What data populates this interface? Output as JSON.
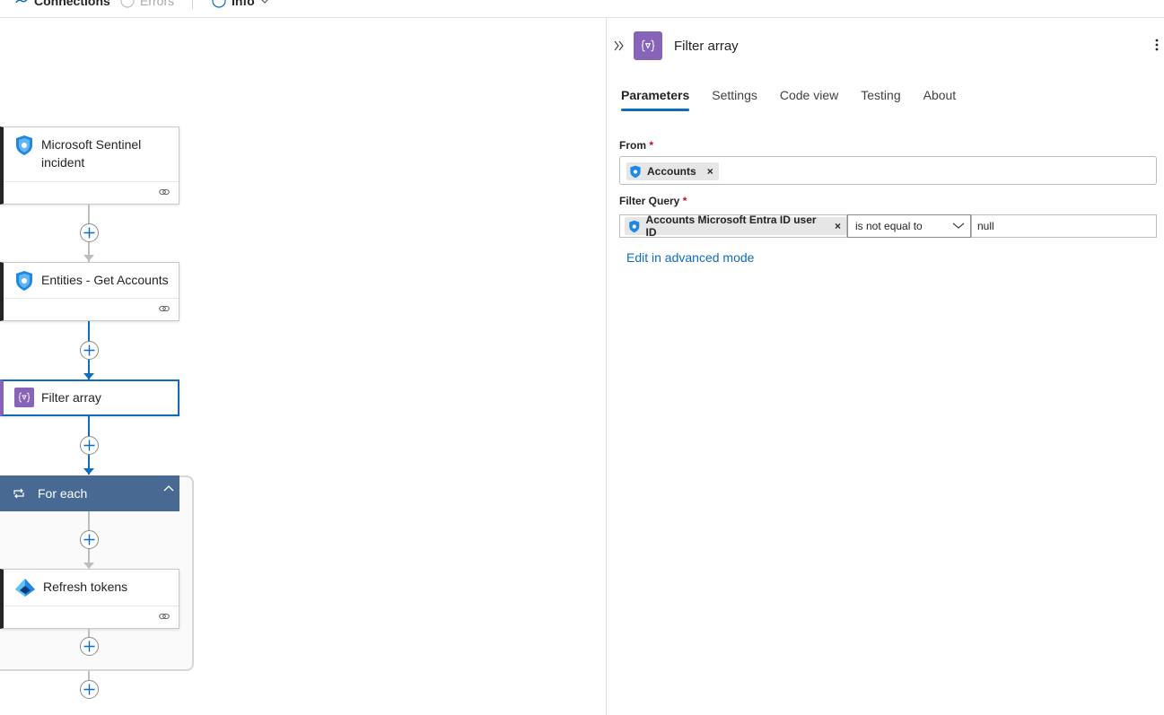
{
  "toolbar": {
    "connections_label": "Connections",
    "errors_label": "Errors",
    "info_label": "Info"
  },
  "canvas": {
    "nodes": {
      "sentinel": {
        "title": "Microsoft Sentinel incident",
        "line1": "Microsoft Sentinel",
        "line2": "incident"
      },
      "entities": {
        "title": "Entities - Get Accounts"
      },
      "filter": {
        "title": "Filter array"
      },
      "foreach": {
        "title": "For each"
      },
      "refresh": {
        "title": "Refresh tokens"
      }
    }
  },
  "panel": {
    "title": "Filter array",
    "tabs": [
      {
        "label": "Parameters",
        "active": true
      },
      {
        "label": "Settings",
        "active": false
      },
      {
        "label": "Code view",
        "active": false
      },
      {
        "label": "Testing",
        "active": false
      },
      {
        "label": "About",
        "active": false
      }
    ],
    "from": {
      "label": "From",
      "required_mark": "*",
      "token": "Accounts"
    },
    "filter_query": {
      "label": "Filter Query",
      "required_mark": "*",
      "left_token": "Accounts Microsoft Entra ID user ID",
      "operator": "is not equal to",
      "right_value": "null"
    },
    "advanced_link": "Edit in advanced mode"
  },
  "colors": {
    "accent": "#0f6cbd",
    "filter_icon": "#8764b8",
    "foreach_header": "#486991",
    "sentinel_blue": "#1e88e5"
  }
}
